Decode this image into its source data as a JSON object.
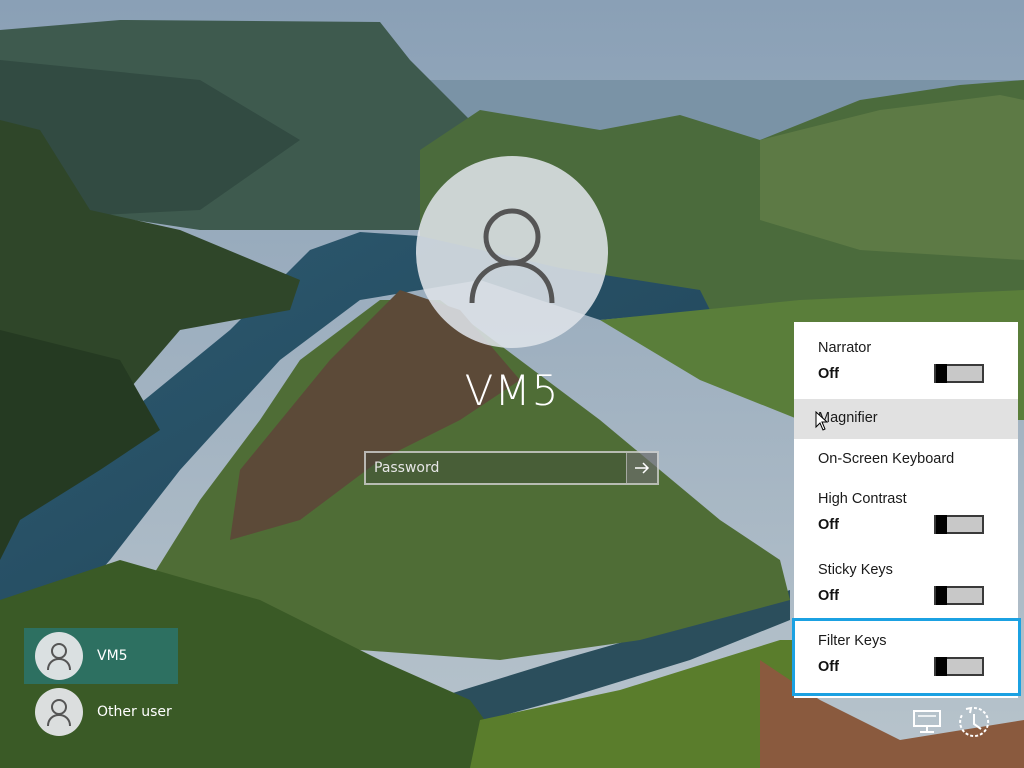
{
  "login": {
    "username": "VM5",
    "password_placeholder": "Password"
  },
  "users": [
    {
      "name": "VM5",
      "selected": true
    },
    {
      "name": "Other user",
      "selected": false
    }
  ],
  "ease_of_access": {
    "items": [
      {
        "label": "Narrator",
        "state": "Off",
        "has_toggle": true
      },
      {
        "label": "Magnifier",
        "hovered": true
      },
      {
        "label": "On-Screen Keyboard"
      },
      {
        "label": "High Contrast",
        "state": "Off",
        "has_toggle": true
      },
      {
        "label": "Sticky Keys",
        "state": "Off",
        "has_toggle": true
      },
      {
        "label": "Filter Keys",
        "state": "Off",
        "has_toggle": true,
        "focused": true
      }
    ]
  },
  "colors": {
    "focus_border": "#1ba1e2",
    "selected_user": "#287878",
    "panel_bg": "#ffffff"
  },
  "icons": [
    "user-icon",
    "arrow-right-icon",
    "network-icon",
    "ease-of-access-icon"
  ]
}
